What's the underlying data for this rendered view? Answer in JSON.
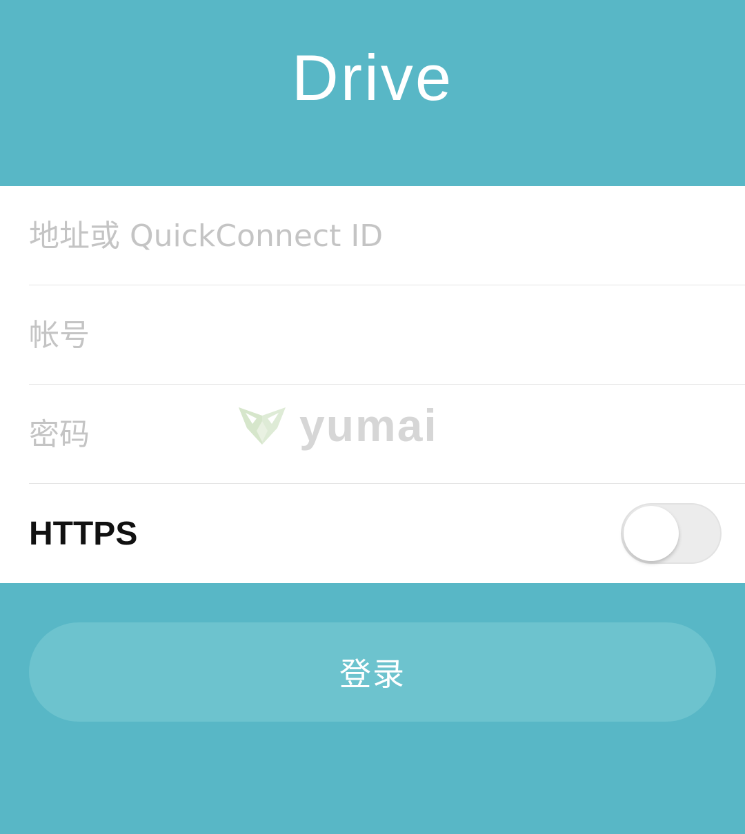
{
  "header": {
    "title": "Drive"
  },
  "form": {
    "address": {
      "placeholder": "地址或 QuickConnect ID",
      "value": ""
    },
    "account": {
      "placeholder": "帐号",
      "value": ""
    },
    "password": {
      "placeholder": "密码",
      "value": ""
    },
    "https": {
      "label": "HTTPS",
      "enabled": false
    }
  },
  "login": {
    "label": "登录"
  },
  "watermark": {
    "text": "yumai"
  },
  "colors": {
    "background": "#58b7c6",
    "button": "#6dc3ce",
    "form": "#ffffff",
    "placeholder": "#c4c4c4"
  },
  "icons": {
    "toggle": "switch-off-icon",
    "watermark": "yumai-logo-icon"
  }
}
